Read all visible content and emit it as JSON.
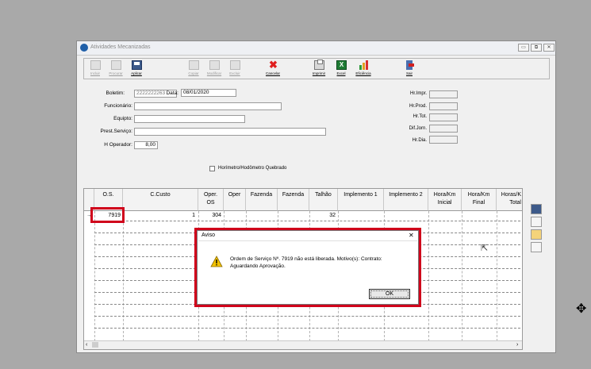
{
  "window": {
    "title": "Atividades Mecanizadas",
    "controls": [
      "▭",
      "⧉",
      "✕"
    ]
  },
  "toolbar": {
    "buttons": [
      {
        "label": "Incluir",
        "enabled": false
      },
      {
        "label": "Procurar",
        "enabled": false
      },
      {
        "label": "Aplicar",
        "enabled": true
      },
      {
        "label": "Copiar",
        "enabled": false
      },
      {
        "label": "Modificar",
        "enabled": false
      },
      {
        "label": "Excluir",
        "enabled": false
      },
      {
        "label": "Cancelar",
        "enabled": true
      },
      {
        "label": "Imprimir",
        "enabled": true
      },
      {
        "label": "Excel",
        "enabled": true
      },
      {
        "label": "Eficiência",
        "enabled": true
      },
      {
        "label": "Sair",
        "enabled": true
      }
    ]
  },
  "form": {
    "boletim_label": "Boletim:",
    "boletim_value": "2222222263",
    "data_label": "Data:",
    "data_value": "08/01/2020",
    "funcionario_label": "Funcionário:",
    "equipto_label": "Equipto:",
    "prest_servico_label": "Prest.Serviço:",
    "h_operador_label": "H Operador:",
    "h_operador_value": "8,00",
    "checkbox_label": "Horímetro/Hodômetro Quebrado"
  },
  "right_fields": [
    "Hr.Impr.",
    "Hr.Prod.",
    "Hr.Tot.",
    "Dif.Jorn.",
    "Hr.Dia."
  ],
  "grid": {
    "columns": [
      "O.S.",
      "C.Custo",
      "Oper.\nOS",
      "Oper",
      "Fazenda",
      "Fazenda",
      "Talhão",
      "Implemento 1",
      "Implemento 2",
      "Hora/Km\nInicial",
      "Hora/Km\nFinal",
      "Horas/K\nTotal"
    ],
    "row_marker": "→",
    "rows": [
      {
        "os": "7919",
        "c_custo": "1",
        "oper_os": "304",
        "talhao": "32"
      }
    ]
  },
  "dialog": {
    "title": "Aviso",
    "message": "Ordem de Serviço Nº. 7919 não está liberada. Motivo(s): Contrato: Aguardando Aprovação.",
    "ok_label": "OK",
    "close": "✕"
  },
  "colors": {
    "highlight": "#d0021b",
    "icon_blue": "#1f5fa8",
    "cancel_red": "#e02020",
    "warning_yellow": "#f2c200"
  }
}
